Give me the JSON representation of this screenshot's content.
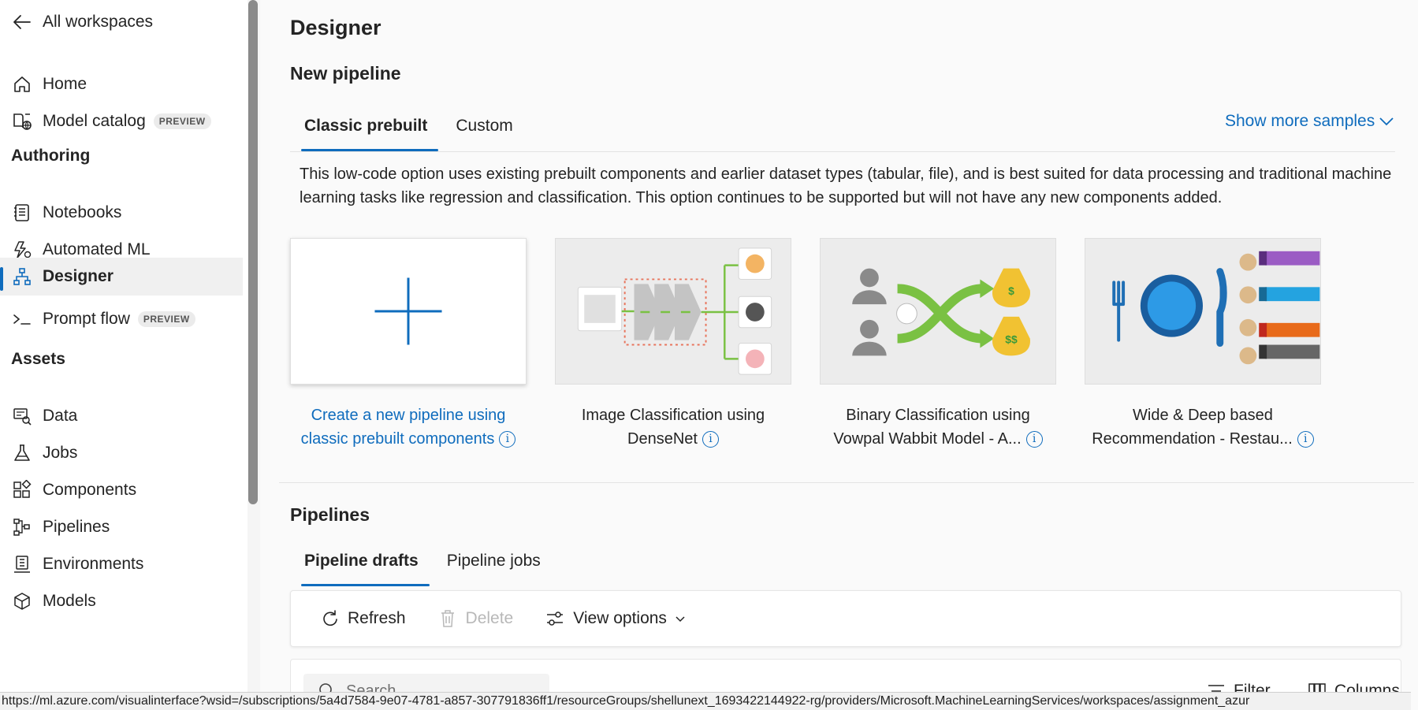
{
  "sidebar": {
    "back_label": "All workspaces",
    "items": [
      {
        "label": "Home"
      },
      {
        "label": "Model catalog",
        "badge": "PREVIEW"
      },
      {
        "label": "Notebooks"
      },
      {
        "label": "Automated ML"
      },
      {
        "label": "Designer"
      },
      {
        "label": "Prompt flow",
        "badge": "PREVIEW"
      },
      {
        "label": "Data"
      },
      {
        "label": "Jobs"
      },
      {
        "label": "Components"
      },
      {
        "label": "Pipelines"
      },
      {
        "label": "Environments"
      },
      {
        "label": "Models"
      }
    ],
    "sections": {
      "authoring": "Authoring",
      "assets": "Assets"
    },
    "active_item": "Designer"
  },
  "main": {
    "title": "Designer",
    "new_pipeline_title": "New pipeline",
    "tabs": [
      {
        "label": "Classic prebuilt"
      },
      {
        "label": "Custom"
      }
    ],
    "show_more": "Show more samples",
    "description": "This low-code option uses existing prebuilt components and earlier dataset types (tabular, file), and is best suited for data processing and traditional machine learning tasks like regression and classification. This option continues to be supported but will not have any new components added.",
    "cards": [
      {
        "line1": "Create a new pipeline using",
        "line2": "classic prebuilt components"
      },
      {
        "line1": "Image Classification using",
        "line2": "DenseNet"
      },
      {
        "line1": "Binary Classification using",
        "line2": "Vowpal Wabbit Model - A..."
      },
      {
        "line1": "Wide & Deep based",
        "line2": "Recommendation - Restau..."
      }
    ],
    "info_glyph": "i",
    "pipelines_title": "Pipelines",
    "pipeline_tabs": [
      {
        "label": "Pipeline drafts"
      },
      {
        "label": "Pipeline jobs"
      }
    ],
    "toolbar": {
      "refresh": "Refresh",
      "delete": "Delete",
      "view_options": "View options"
    },
    "search_placeholder": "Search",
    "filter_label": "Filter",
    "columns_label": "Columns"
  },
  "status_url": "https://ml.azure.com/visualinterface?wsid=/subscriptions/5a4d7584-9e07-4781-a857-307791836ff1/resourceGroups/shellunext_1693422144922-rg/providers/Microsoft.MachineLearningServices/workspaces/assignment_azur",
  "colors": {
    "accent": "#0f6cbd",
    "green": "#7ac143",
    "plate_blue": "#1f8ed8"
  }
}
